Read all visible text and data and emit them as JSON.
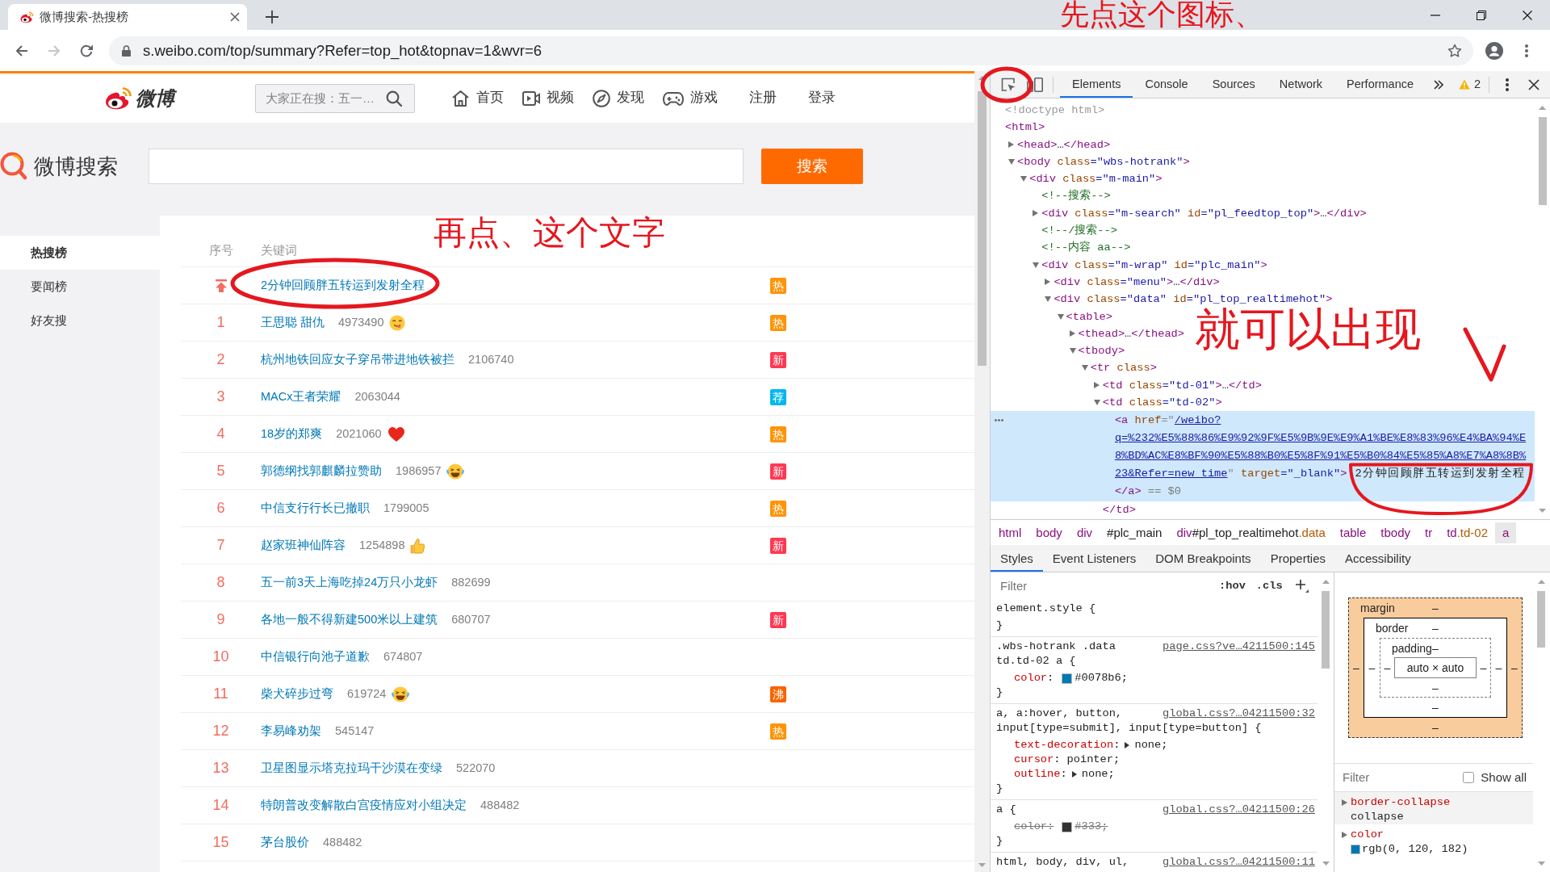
{
  "browser": {
    "tab_title": "微博搜索-热搜榜",
    "url": "s.weibo.com/top/summary?Refer=top_hot&topnav=1&wvr=6",
    "forward_disabled": true
  },
  "weibo_header": {
    "logo_text": "微博",
    "search_placeholder": "大家正在搜：五一…",
    "nav": [
      {
        "kind": "home",
        "label": "首页"
      },
      {
        "kind": "video",
        "label": "视频"
      },
      {
        "kind": "discover",
        "label": "发现"
      },
      {
        "kind": "game",
        "label": "游戏"
      },
      {
        "kind": "link",
        "label": "注册"
      },
      {
        "kind": "link",
        "label": "登录"
      }
    ]
  },
  "search_band": {
    "logo_text": "微博搜索",
    "button": "搜索"
  },
  "sidebar": {
    "items": [
      {
        "label": "热搜榜",
        "selected": true
      },
      {
        "label": "要闻榜",
        "selected": false
      },
      {
        "label": "好友搜",
        "selected": false
      }
    ]
  },
  "hot_list": {
    "columns": [
      "序号",
      "关键词"
    ],
    "rows": [
      {
        "kind": "pinned",
        "keyword": "2分钟回顾胖五转运到发射全程",
        "badge": {
          "text": "热",
          "color": "#ff9406"
        }
      },
      {
        "kind": "ranked",
        "rank": "1",
        "keyword": "王思聪 甜仇",
        "count": "4973490",
        "emoji": {
          "kind": "yum"
        },
        "badge": {
          "text": "热",
          "color": "#ff9406"
        }
      },
      {
        "kind": "ranked",
        "rank": "2",
        "keyword": "杭州地铁回应女子穿吊带进地铁被拦",
        "count": "2106740",
        "badge": {
          "text": "新",
          "color": "#ff3852"
        }
      },
      {
        "kind": "ranked",
        "rank": "3",
        "keyword": "MACx王者荣耀",
        "count": "2063044",
        "badge": {
          "text": "荐",
          "color": "#00b7ee"
        }
      },
      {
        "kind": "ranked",
        "rank": "4",
        "keyword": "18岁的郑爽",
        "count": "2021060",
        "emoji": {
          "kind": "heart"
        },
        "badge": {
          "text": "热",
          "color": "#ff9406"
        }
      },
      {
        "kind": "ranked",
        "rank": "5",
        "keyword": "郭德纲找郭麒麟拉赞助",
        "count": "1986957",
        "emoji": {
          "kind": "laugh"
        },
        "badge": {
          "text": "新",
          "color": "#ff3852"
        }
      },
      {
        "kind": "ranked",
        "rank": "6",
        "keyword": "中信支行行长已撤职",
        "count": "1799005",
        "badge": {
          "text": "热",
          "color": "#ff9406"
        }
      },
      {
        "kind": "ranked",
        "rank": "7",
        "keyword": "赵家班神仙阵容",
        "count": "1254898",
        "emoji": {
          "kind": "thumbs_up"
        },
        "badge": {
          "text": "新",
          "color": "#ff3852"
        }
      },
      {
        "kind": "ranked",
        "rank": "8",
        "keyword": "五一前3天上海吃掉24万只小龙虾",
        "count": "882699"
      },
      {
        "kind": "ranked",
        "rank": "9",
        "keyword": "各地一般不得新建500米以上建筑",
        "count": "680707",
        "badge": {
          "text": "新",
          "color": "#ff3852"
        }
      },
      {
        "kind": "ranked",
        "rank": "10",
        "keyword": "中信银行向池子道歉",
        "count": "674807"
      },
      {
        "kind": "ranked",
        "rank": "11",
        "keyword": "柴犬碎步过弯",
        "count": "619724",
        "emoji": {
          "kind": "laugh"
        },
        "badge": {
          "text": "沸",
          "color": "#f86400"
        }
      },
      {
        "kind": "ranked",
        "rank": "12",
        "keyword": "李易峰劝架",
        "count": "545147",
        "badge": {
          "text": "热",
          "color": "#ff9406"
        }
      },
      {
        "kind": "ranked",
        "rank": "13",
        "keyword": "卫星图显示塔克拉玛干沙漠在变绿",
        "count": "522070"
      },
      {
        "kind": "ranked",
        "rank": "14",
        "keyword": "特朗普改变解散白宫疫情应对小组决定",
        "count": "488482"
      },
      {
        "kind": "ranked",
        "rank": "15",
        "keyword": "茅台股价",
        "count": "488482"
      }
    ]
  },
  "devtools": {
    "tabs": [
      {
        "label": "Elements",
        "selected": true
      },
      {
        "label": "Console",
        "selected": false
      },
      {
        "label": "Sources",
        "selected": false
      },
      {
        "label": "Network",
        "selected": false
      },
      {
        "label": "Performance",
        "selected": false
      }
    ],
    "warning_count": "2",
    "dom_tree": [
      {
        "parts": [
          {
            "kind": "doctype",
            "text": "<!doctype html>"
          }
        ],
        "selected": false
      },
      {
        "parts": [
          {
            "kind": "tag",
            "text": "<html>"
          }
        ],
        "selected": false,
        "children": [
          {
            "parts": [
              {
                "kind": "tag",
                "text": "<head>"
              },
              {
                "kind": "ellipsis",
                "text": "…"
              },
              {
                "kind": "tag",
                "text": "</head>"
              }
            ],
            "expanded": false,
            "selected": false
          },
          {
            "parts": [
              {
                "kind": "tag",
                "text": "<body"
              },
              {
                "kind": "attr_name",
                "text": " class"
              },
              {
                "kind": "attr_value",
                "text": "=\"wbs-hotrank\""
              },
              {
                "kind": "tag",
                "text": ">"
              }
            ],
            "expanded": true,
            "selected": false,
            "children": [
              {
                "parts": [
                  {
                    "kind": "tag",
                    "text": "<div"
                  },
                  {
                    "kind": "attr_name",
                    "text": " class"
                  },
                  {
                    "kind": "attr_value",
                    "text": "=\"m-main\""
                  },
                  {
                    "kind": "tag",
                    "text": ">"
                  }
                ],
                "expanded": true,
                "selected": false,
                "children": [
                  {
                    "parts": [
                      {
                        "kind": "comment",
                        "text": "<!--搜索-->"
                      }
                    ],
                    "selected": false
                  },
                  {
                    "parts": [
                      {
                        "kind": "tag",
                        "text": "<div"
                      },
                      {
                        "kind": "attr_name",
                        "text": " class"
                      },
                      {
                        "kind": "attr_value",
                        "text": "=\"m-search\""
                      },
                      {
                        "kind": "attr_name",
                        "text": " id"
                      },
                      {
                        "kind": "attr_value",
                        "text": "=\"pl_feedtop_top\""
                      },
                      {
                        "kind": "tag",
                        "text": ">"
                      },
                      {
                        "kind": "ellipsis",
                        "text": "…"
                      },
                      {
                        "kind": "tag",
                        "text": "</div>"
                      }
                    ],
                    "expanded": false,
                    "selected": false
                  },
                  {
                    "parts": [
                      {
                        "kind": "comment",
                        "text": "<!--/搜索-->"
                      }
                    ],
                    "selected": false
                  },
                  {
                    "parts": [
                      {
                        "kind": "comment",
                        "text": "<!--内容 aa-->"
                      }
                    ],
                    "selected": false
                  },
                  {
                    "parts": [
                      {
                        "kind": "tag",
                        "text": "<div"
                      },
                      {
                        "kind": "attr_name",
                        "text": " class"
                      },
                      {
                        "kind": "attr_value",
                        "text": "=\"m-wrap\""
                      },
                      {
                        "kind": "attr_name",
                        "text": " id"
                      },
                      {
                        "kind": "attr_value",
                        "text": "=\"plc_main\""
                      },
                      {
                        "kind": "tag",
                        "text": ">"
                      }
                    ],
                    "expanded": true,
                    "selected": false,
                    "children": [
                      {
                        "parts": [
                          {
                            "kind": "tag",
                            "text": "<div"
                          },
                          {
                            "kind": "attr_name",
                            "text": " class"
                          },
                          {
                            "kind": "attr_value",
                            "text": "=\"menu\""
                          },
                          {
                            "kind": "tag",
                            "text": ">"
                          },
                          {
                            "kind": "ellipsis",
                            "text": "…"
                          },
                          {
                            "kind": "tag",
                            "text": "</div>"
                          }
                        ],
                        "expanded": false,
                        "selected": false
                      },
                      {
                        "parts": [
                          {
                            "kind": "tag",
                            "text": "<div"
                          },
                          {
                            "kind": "attr_name",
                            "text": " class"
                          },
                          {
                            "kind": "attr_value",
                            "text": "=\"data\""
                          },
                          {
                            "kind": "attr_name",
                            "text": " id"
                          },
                          {
                            "kind": "attr_value",
                            "text": "=\"pl_top_realtimehot\""
                          },
                          {
                            "kind": "tag",
                            "text": ">"
                          }
                        ],
                        "expanded": true,
                        "selected": false,
                        "children": [
                          {
                            "parts": [
                              {
                                "kind": "tag",
                                "text": "<table>"
                              }
                            ],
                            "expanded": true,
                            "selected": false,
                            "children": [
                              {
                                "parts": [
                                  {
                                    "kind": "tag",
                                    "text": "<thead>"
                                  },
                                  {
                                    "kind": "ellipsis",
                                    "text": "…"
                                  },
                                  {
                                    "kind": "tag",
                                    "text": "</thead>"
                                  }
                                ],
                                "expanded": false,
                                "selected": false
                              },
                              {
                                "parts": [
                                  {
                                    "kind": "tag",
                                    "text": "<tbody>"
                                  }
                                ],
                                "expanded": true,
                                "selected": false,
                                "children": [
                                  {
                                    "parts": [
                                      {
                                        "kind": "tag",
                                        "text": "<tr"
                                      },
                                      {
                                        "kind": "attr_name",
                                        "text": " class"
                                      },
                                      {
                                        "kind": "tag",
                                        "text": ">"
                                      }
                                    ],
                                    "expanded": true,
                                    "selected": false,
                                    "children": [
                                      {
                                        "parts": [
                                          {
                                            "kind": "tag",
                                            "text": "<td"
                                          },
                                          {
                                            "kind": "attr_name",
                                            "text": " class"
                                          },
                                          {
                                            "kind": "attr_value",
                                            "text": "=\"td-01\""
                                          },
                                          {
                                            "kind": "tag",
                                            "text": ">"
                                          },
                                          {
                                            "kind": "ellipsis",
                                            "text": "…"
                                          },
                                          {
                                            "kind": "tag",
                                            "text": "</td>"
                                          }
                                        ],
                                        "expanded": false,
                                        "selected": false
                                      },
                                      {
                                        "parts": [
                                          {
                                            "kind": "tag",
                                            "text": "<td"
                                          },
                                          {
                                            "kind": "attr_name",
                                            "text": " class"
                                          },
                                          {
                                            "kind": "attr_value",
                                            "text": "=\"td-02\""
                                          },
                                          {
                                            "kind": "tag",
                                            "text": ">"
                                          }
                                        ],
                                        "expanded": true,
                                        "selected": false,
                                        "closing": [
                                          {
                                            "kind": "tag",
                                            "text": "</td>"
                                          }
                                        ],
                                        "children": [
                                          {
                                            "parts": [
                                              {
                                                "kind": "tag",
                                                "text": "<a"
                                              },
                                              {
                                                "kind": "attr_name",
                                                "text": " href"
                                              },
                                              {
                                                "kind": "punct",
                                                "text": "=\""
                                              },
                                              {
                                                "kind": "link",
                                                "text": "/weibo?q=%232%E5%88%86%E9%92%9F%E5%9B%9E%E9%A1%BE%E8%83%96%E4%BA%94%E8%BD%AC%E8%BF%90%E5%88%B0%E5%8F%91%E5%B0%84%E5%85%A8%E7%A8%8B%23&Refer=new_time"
                                              },
                                              {
                                                "kind": "punct",
                                                "text": "\""
                                              },
                                              {
                                                "kind": "attr_name",
                                                "text": " target"
                                              },
                                              {
                                                "kind": "attr_value",
                                                "text": "=\"_blank\""
                                              },
                                              {
                                                "kind": "tag",
                                                "text": ">"
                                              },
                                              {
                                                "kind": "text",
                                                "text": "2分钟回顾胖五转运到发射全程"
                                              },
                                              {
                                                "kind": "tag",
                                                "text": "</a>"
                                              },
                                              {
                                                "kind": "marker",
                                                "text": " == $0"
                                              }
                                            ],
                                            "selected": true
                                          }
                                        ]
                                      }
                                    ]
                                  }
                                ]
                              }
                            ]
                          }
                        ]
                      }
                    ]
                  }
                ]
              }
            ]
          }
        ]
      }
    ],
    "breadcrumbs": [
      {
        "tag": "html",
        "selected": false
      },
      {
        "tag": "body",
        "selected": false
      },
      {
        "tag": "div",
        "selected": false
      },
      {
        "id": "#plc_main",
        "selected": false
      },
      {
        "tag": "div",
        "id": "#pl_top_realtimehot",
        "class": ".data",
        "selected": false
      },
      {
        "tag": "table",
        "selected": false
      },
      {
        "tag": "tbody",
        "selected": false
      },
      {
        "tag": "tr",
        "selected": false
      },
      {
        "tag": "td",
        "class": ".td-02",
        "selected": false
      },
      {
        "tag": "a",
        "selected": true
      }
    ],
    "sidebar_tabs": [
      {
        "label": "Styles",
        "selected": true
      },
      {
        "label": "Event Listeners",
        "selected": false
      },
      {
        "label": "DOM Breakpoints",
        "selected": false
      },
      {
        "label": "Properties",
        "selected": false
      },
      {
        "label": "Accessibility",
        "selected": false
      }
    ],
    "styles": {
      "filter_placeholder": "Filter",
      "hov": ":hov",
      "cls": ".cls",
      "rules": [
        {
          "selector_lines": [
            "element.style {"
          ],
          "closing": "}"
        },
        {
          "selector_lines": [
            ".wbs-hotrank .data",
            "td.td-02 a {"
          ],
          "source": "page.css?ve…4211500:145",
          "declarations": [
            {
              "name": "color",
              "separator": ":",
              "value": "#0078b6;",
              "color": "#0078b6",
              "expandable": false,
              "overridden": false
            }
          ],
          "closing": "}"
        },
        {
          "selector_lines": [
            "a, a:hover, button,",
            "input[type=submit], input[type=button] {"
          ],
          "source": "global.css?…04211500:32",
          "declarations": [
            {
              "name": "text-decoration",
              "separator": ":",
              "value": "none;",
              "expandable": true,
              "overridden": false
            },
            {
              "name": "cursor",
              "separator": ":",
              "value": "pointer;",
              "expandable": false,
              "overridden": false
            },
            {
              "name": "outline",
              "separator": ":",
              "value": "none;",
              "expandable": true,
              "overridden": false
            }
          ],
          "closing": "}"
        },
        {
          "selector_lines": [
            "a {"
          ],
          "source": "global.css?…04211500:26",
          "declarations": [
            {
              "name": "color",
              "separator": ":",
              "value": "#333;",
              "color": "#333333",
              "expandable": false,
              "overridden": true
            }
          ],
          "closing": "}"
        },
        {
          "selector_lines": [
            "html, body, div, ul,"
          ],
          "source": "global.css?…04211500:11"
        }
      ]
    },
    "computed": {
      "box_model": {
        "margin": {
          "label": "margin",
          "top": "–",
          "right": "–",
          "bottom": "–",
          "left": "–"
        },
        "border": {
          "label": "border",
          "top": "–",
          "right": "–",
          "bottom": "–",
          "left": "–"
        },
        "padding": {
          "label": "padding",
          "top": "–",
          "right": "–",
          "bottom": "–",
          "left": "–"
        },
        "content": "auto × auto"
      },
      "filter_placeholder": "Filter",
      "show_all": {
        "label": "Show all",
        "checked": false
      },
      "properties": [
        {
          "name": "border-collapse",
          "value": "collapse",
          "expanded": false,
          "hovered": true
        },
        {
          "name": "color",
          "value": "rgb(0, 120, 182)",
          "color": "#0078b6",
          "expanded": false,
          "hovered": false
        }
      ]
    }
  },
  "annotations": [
    {
      "text": "先点这个图标、"
    },
    {
      "text": "再点、这个文字"
    },
    {
      "text": "就可以出现"
    }
  ]
}
